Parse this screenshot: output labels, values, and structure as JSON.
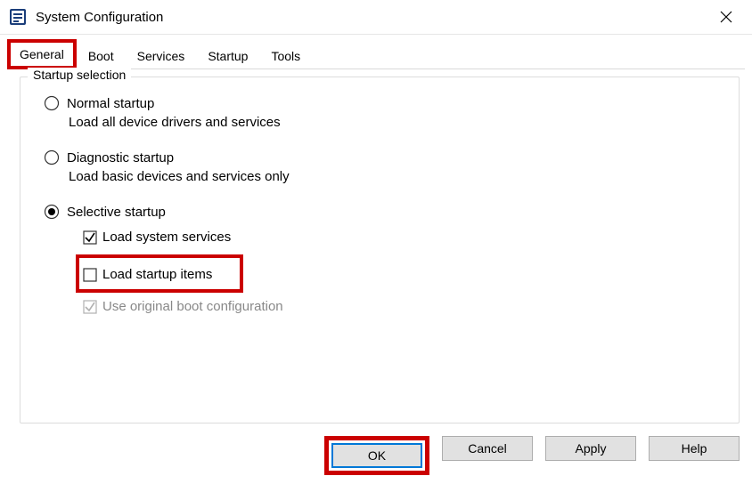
{
  "window": {
    "title": "System Configuration"
  },
  "tabs": {
    "general": "General",
    "boot": "Boot",
    "services": "Services",
    "startup": "Startup",
    "tools": "Tools"
  },
  "group": {
    "label": "Startup selection",
    "normal": {
      "label": "Normal startup",
      "desc": "Load all device drivers and services"
    },
    "diagnostic": {
      "label": "Diagnostic startup",
      "desc": "Load basic devices and services only"
    },
    "selective": {
      "label": "Selective startup",
      "load_system_services": "Load system services",
      "load_startup_items": "Load startup items",
      "use_original_boot": "Use original boot configuration"
    }
  },
  "buttons": {
    "ok": "OK",
    "cancel": "Cancel",
    "apply": "Apply",
    "help": "Help"
  }
}
